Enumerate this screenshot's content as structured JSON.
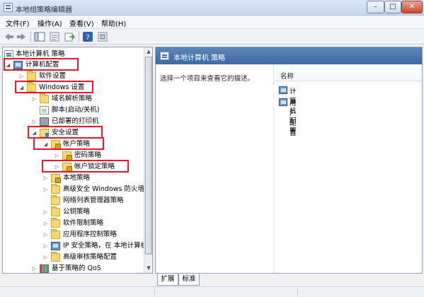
{
  "window": {
    "title": "本地组策略编辑器",
    "buttons": {
      "minimize": "–",
      "maximize": "□",
      "close": "✕"
    }
  },
  "menu": {
    "items": [
      "文件(F)",
      "操作(A)",
      "查看(V)",
      "帮助(H)"
    ]
  },
  "toolbar": {
    "icons": [
      "back-arrow-icon",
      "forward-arrow-icon",
      "show-tree-icon",
      "properties-icon",
      "export-icon",
      "help-icon",
      "filter-icon"
    ]
  },
  "tree": {
    "root": "本地计算机 策略",
    "computer_config": "计算机配置",
    "software_settings": "软件设置",
    "windows_settings": "Windows 设置",
    "dns_policy": "域名解析策略",
    "scripts": "脚本(启动/关机)",
    "printers": "已部署的打印机",
    "security_settings": "安全设置",
    "account_policy": "帐户策略",
    "password_policy": "密码策略",
    "lockout_policy": "帐户锁定策略",
    "local_policy": "本地策略",
    "firewall": "高级安全 Windows 防火墙",
    "network_list": "网络列表管理器策略",
    "public_key": "公钥策略",
    "software_restriction": "软件限制策略",
    "app_control": "应用程序控制策略",
    "ip_security": "IP 安全策略，在 本地计算机",
    "audit_policy": "高级审核策略配置",
    "qos": "基于策略的 QoS"
  },
  "right": {
    "header": "本地计算机 策略",
    "description": "选择一个项目来查看它的描述。",
    "column_name": "名称",
    "items": [
      "计算机配置",
      "用户配置"
    ]
  },
  "tabs": {
    "extended": "扩展",
    "standard": "标准"
  },
  "colors": {
    "highlight_box": "#e8182c",
    "header_blue": "#4a76ad"
  }
}
